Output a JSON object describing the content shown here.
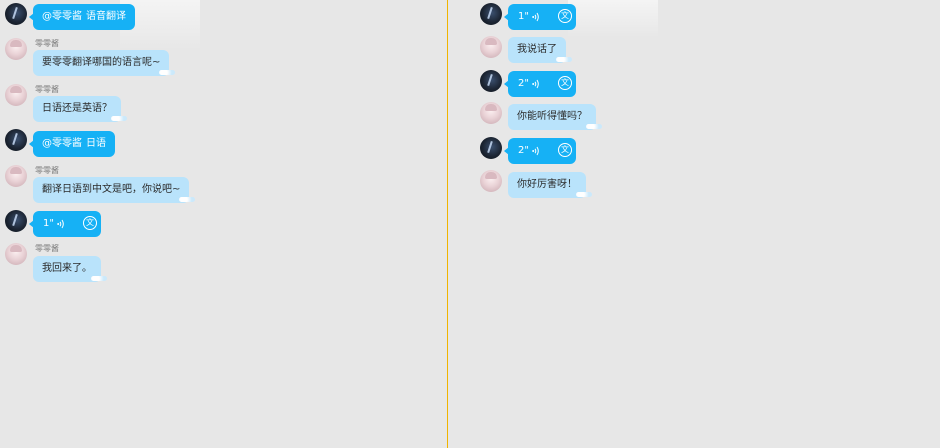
{
  "left_chat": {
    "messages": [
      {
        "side": "me",
        "mention": "@零零酱",
        "text": "语音翻译"
      },
      {
        "side": "her",
        "sender": "零零酱",
        "text": "要零零翻译哪国的语言呢~"
      },
      {
        "side": "her",
        "sender": "零零酱",
        "text": "日语还是英语？"
      },
      {
        "side": "me",
        "mention": "@零零酱",
        "text": "日语"
      },
      {
        "side": "her",
        "sender": "零零酱",
        "text": "翻译日语到中文是吧，你说吧~"
      },
      {
        "side": "me",
        "voice_duration": "1\"",
        "translate_glyph": "文"
      },
      {
        "side": "her",
        "sender": "零零酱",
        "text": "我回来了。"
      }
    ]
  },
  "right_chat": {
    "messages": [
      {
        "side": "me",
        "voice_duration": "1\"",
        "translate_glyph": "文"
      },
      {
        "side": "her",
        "text": "我说话了"
      },
      {
        "side": "me",
        "voice_duration": "2\"",
        "translate_glyph": "文"
      },
      {
        "side": "her",
        "text": "你能听得懂吗？"
      },
      {
        "side": "me",
        "voice_duration": "2\"",
        "translate_glyph": "文"
      },
      {
        "side": "her",
        "text": "你好厉害呀！"
      }
    ]
  },
  "colors": {
    "background": "#e7e7e7",
    "bubble_dark": "#16b1f5",
    "bubble_light": "#b9e3fb",
    "divider": "#f0b400"
  },
  "icons": [
    "voice-wave-icon",
    "translate-icon"
  ]
}
